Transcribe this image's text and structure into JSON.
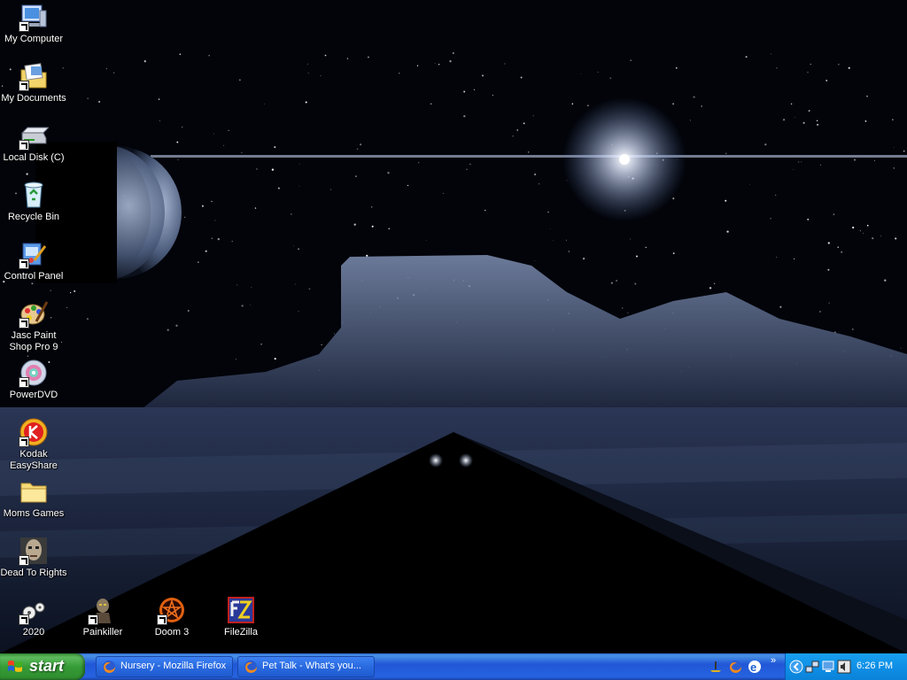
{
  "desktop": {
    "icons": [
      {
        "label": "My Computer",
        "icon": "my-computer-icon"
      },
      {
        "label": "My Documents",
        "icon": "my-documents-icon"
      },
      {
        "label": "Local Disk (C)",
        "icon": "local-disk-icon"
      },
      {
        "label": "Recycle Bin",
        "icon": "recycle-bin-icon"
      },
      {
        "label": "Control Panel",
        "icon": "control-panel-icon"
      },
      {
        "label": "Jasc Paint Shop Pro 9",
        "icon": "paint-shop-pro-icon"
      },
      {
        "label": "PowerDVD",
        "icon": "powerdvd-icon"
      },
      {
        "label": "Kodak EasyShare",
        "icon": "kodak-easyshare-icon"
      },
      {
        "label": "Moms Games",
        "icon": "folder-icon"
      },
      {
        "label": "Dead To Rights",
        "icon": "dead-to-rights-icon"
      },
      {
        "label": "2020",
        "icon": "2020-icon"
      },
      {
        "label": "Painkiller",
        "icon": "painkiller-icon"
      },
      {
        "label": "Doom 3",
        "icon": "doom3-icon"
      },
      {
        "label": "FileZilla",
        "icon": "filezilla-icon"
      }
    ]
  },
  "taskbar": {
    "start_label": "start",
    "tasks": [
      {
        "label": "Nursery - Mozilla Firefox",
        "icon": "firefox-icon"
      },
      {
        "label": "Pet Talk - What's you...",
        "icon": "firefox-icon"
      }
    ],
    "quick_launch": [
      "show-desktop-icon",
      "firefox-icon",
      "ie-icon"
    ],
    "tray_icons": [
      "chevron-left-icon",
      "network-icon",
      "display-icon",
      "volume-icon"
    ],
    "clock": "6:26 PM"
  },
  "colors": {
    "taskbar": "#2663e0",
    "start_button": "#369c36",
    "tray": "#0f8fe6"
  }
}
